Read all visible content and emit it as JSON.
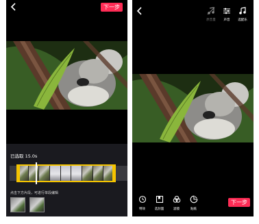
{
  "left_screen": {
    "back_icon": "chevron-left-icon",
    "next_label": "下一步",
    "selected_text": "已选取 15.0s",
    "tip_text": "点击下方片段，可进行单段编辑"
  },
  "right_screen": {
    "back_icon": "chevron-left-icon",
    "tools_top": [
      {
        "icon": "music-off-icon",
        "label": "原音量"
      },
      {
        "icon": "sliders-icon",
        "label": "声音"
      },
      {
        "icon": "music-note-icon",
        "label": "选配乐"
      }
    ],
    "tools_bottom": [
      {
        "icon": "timer-icon",
        "label": "特效"
      },
      {
        "icon": "bookmark-icon",
        "label": "选封面"
      },
      {
        "icon": "filter-circles-icon",
        "label": "滤镜"
      },
      {
        "icon": "sticker-icon",
        "label": "贴纸"
      }
    ],
    "next_label": "下一步"
  },
  "colors": {
    "accent": "#fe2c55",
    "trim_yellow": "#f5c400",
    "background": "#000000"
  }
}
